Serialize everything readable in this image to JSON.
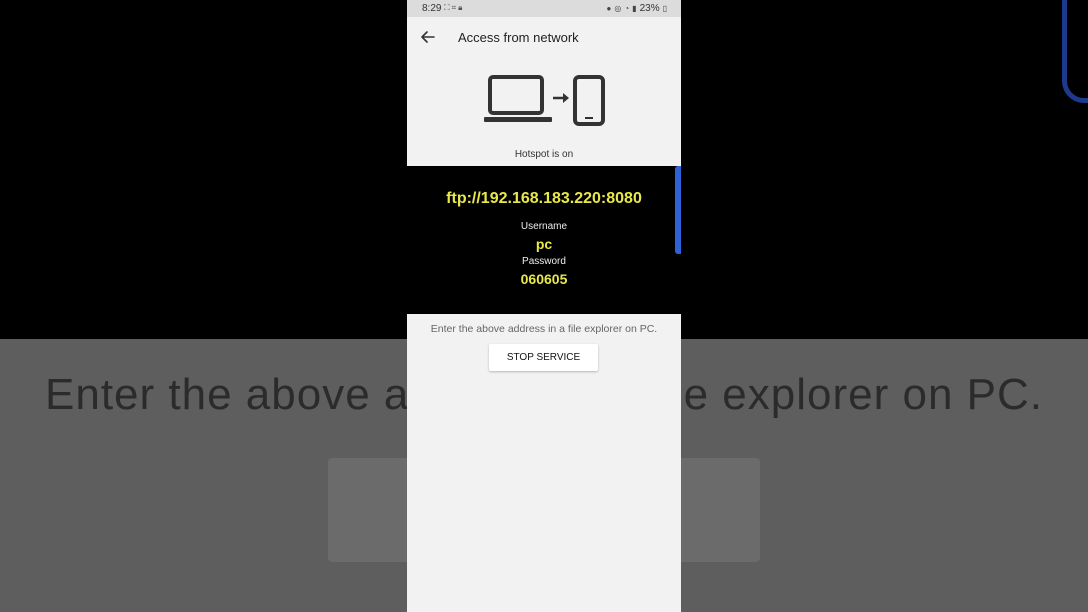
{
  "status_bar": {
    "time": "8:29",
    "battery": "23%",
    "left_icons": [
      "screen-record-icon",
      "expand-icon",
      "scan-icon",
      "lock-icon"
    ],
    "right_icons": [
      "alarm-icon",
      "hotspot-icon",
      "wifi-icon",
      "signal-icon",
      "battery-icon"
    ]
  },
  "app_bar": {
    "title": "Access from network"
  },
  "hotspot_status": "Hotspot is on",
  "connection": {
    "url": "ftp://192.168.183.220:8080",
    "username_label": "Username",
    "username": "pc",
    "password_label": "Password",
    "password": "060605"
  },
  "hint": "Enter the above address in a file explorer on PC.",
  "stop_button": "STOP SERVICE",
  "background": {
    "zoomed_text": "Enter the above address in a file explorer on PC."
  },
  "colors": {
    "accent_yellow": "#e8e84a",
    "scroll_blue": "#2d63d6"
  }
}
